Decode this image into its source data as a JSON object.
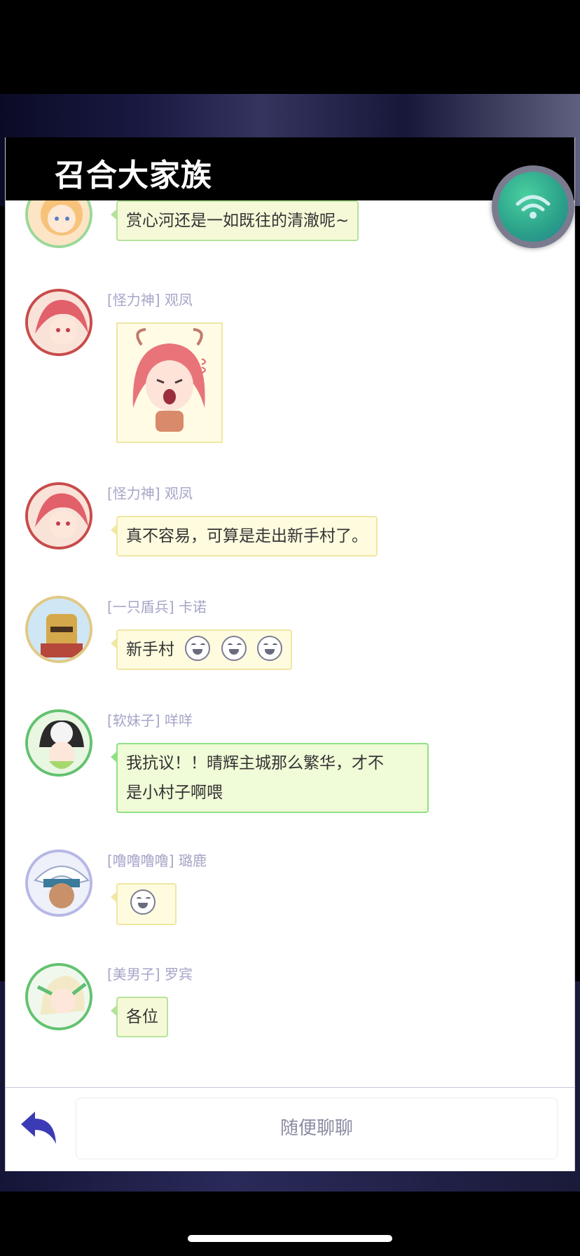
{
  "window": {
    "title": "召合大家族"
  },
  "messages": [
    {
      "sender": "",
      "text": "赏心河还是一如既往的清澈呢~",
      "emojis": 0
    },
    {
      "sender": "[怪力神] 观凤",
      "text": "",
      "sticker": true
    },
    {
      "sender": "[怪力神] 观凤",
      "text": "真不容易，可算是走出新手村了。",
      "emojis": 0
    },
    {
      "sender": "[一只盾兵] 卡诺",
      "text": "新手村",
      "emojis": 3
    },
    {
      "sender": "[软妹子] 咩咩",
      "text": "我抗议！！晴辉主城那么繁华，才不是小村子啊喂",
      "line1": "我抗议！！晴辉主城那么繁华，才不",
      "line2": "是小村子啊喂"
    },
    {
      "sender": "[噜噜噜噜] 璐鹿",
      "text": "",
      "emojis": 1
    },
    {
      "sender": "[美男子] 罗宾",
      "text": "各位",
      "emojis": 0
    }
  ],
  "input": {
    "placeholder": "随便聊聊"
  },
  "icons": {
    "back": "back-arrow-icon",
    "wifi": "wifi-icon",
    "emoji": "laughing-emoji-icon"
  },
  "colors": {
    "header_bg": "#000000",
    "bubble_green_border": "#b5e39a",
    "bubble_yellow_border": "#f0e7a3",
    "sender_text": "#a5a5c8",
    "back_icon": "#3b3bb5"
  }
}
